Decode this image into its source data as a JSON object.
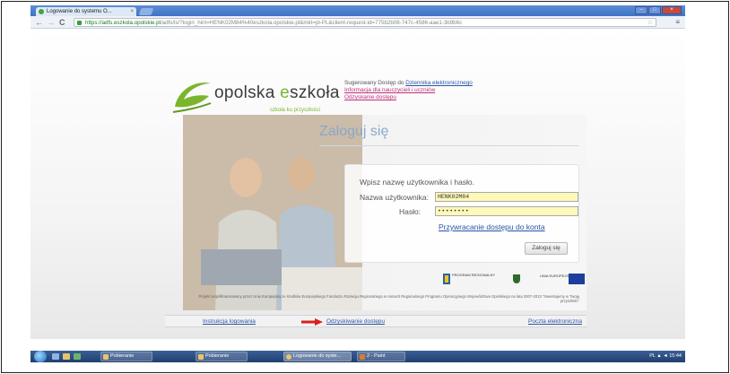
{
  "browser": {
    "tab_title": "Logowanie do systemu O...",
    "tab_close": "×",
    "url_scheme": "https://",
    "url_host": "adfs.eszkola.opolskie.pl",
    "url_rest": "/adfs/ls/?login_hint=HENK02M84%40eszkola.opolskie.pl&mkt=pl-PL&client-request-id=775b2b08-747c-4586-aae1-3b9b6c",
    "back_icon": "←",
    "forward_icon": "→",
    "reload_icon": "C",
    "star_icon": "☆",
    "menu_icon": "≡",
    "minimize": "–",
    "maximize": "□",
    "close": "×"
  },
  "header": {
    "logo_word1": "opolska ",
    "logo_e": "e",
    "logo_word2": "szkoła",
    "logo_tagline": "szkoła ku przyszłości",
    "note1_prefix": "Sugerowany Dostęp do ",
    "note1_link": "Dziennika elektronicznego",
    "note2": "Informacja dla nauczycieli i uczniów",
    "note3": "Odzyskanie dostępu"
  },
  "login": {
    "title": "Zaloguj się",
    "prompt": "Wpisz nazwę użytkownika i hasło.",
    "username_label": "Nazwa użytkownika:",
    "username_value": "HENK02M84",
    "password_label": "Hasło:",
    "password_value": "••••••••",
    "recover_link": "Przywracanie dostępu do konta",
    "submit": "Zaloguj się"
  },
  "sponsors": {
    "pkl": "PROGRAM REGIONALNY",
    "ue": "UNIA EUROPEJSKA"
  },
  "fineprint": "Projekt współfinansowany przez Unię Europejską ze środków Europejskiego Funduszu Rozwoju Regionalnego w ramach Regionalnego Programu Operacyjnego Województwa Opolskiego na lata 2007-2013 \"Inwestujemy w Twoją przyszłość\"",
  "footer": {
    "instructions": "Instrukcja logowania",
    "recover": "Odzyskiwanie dostępu",
    "mail": "Poczta elektroniczna"
  },
  "taskbar": {
    "btn1": "Pobieranie",
    "btn2": "Pobieranie",
    "btn3": "Logowanie do syste...",
    "btn4": "2 - Paint",
    "clock": "PL ▲ ◄ 15:44"
  },
  "colors": {
    "accent_green": "#7ab52d",
    "link_blue": "#2a55a8",
    "link_magenta": "#c0307a",
    "input_yellow": "#fff8b8"
  }
}
